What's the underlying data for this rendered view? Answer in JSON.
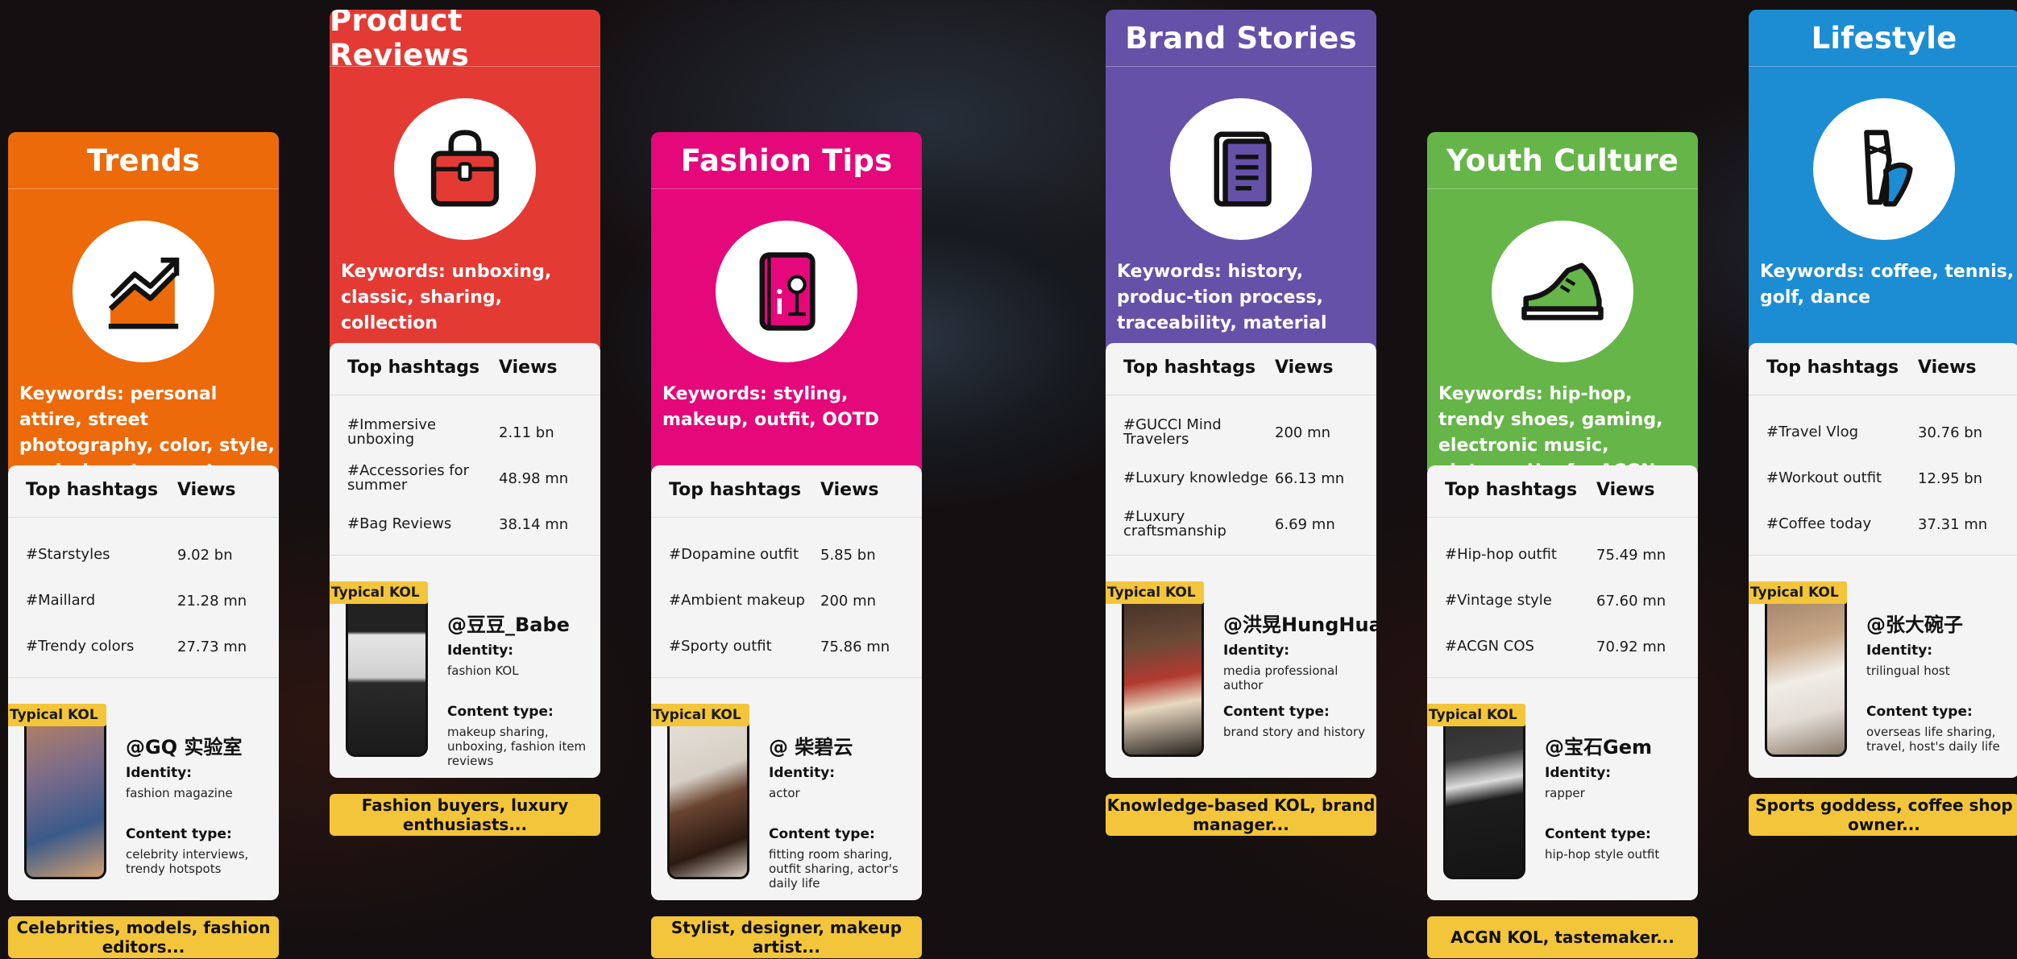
{
  "labels": {
    "top_hashtags": "Top hashtags",
    "views": "Views",
    "typical_kol": "Typical KOL",
    "identity": "Identity:",
    "content_type": "Content type:"
  },
  "columns": [
    {
      "title": "Trends",
      "color": "#ec6a0a",
      "icon": "trend-chart-icon",
      "keywords": "Keywords: personal attire, street photography, color, style, exploring stores, star styles",
      "hashtags": [
        {
          "tag": "#Starstyles",
          "views": "9.02 bn"
        },
        {
          "tag": "#Maillard",
          "views": "21.28 mn"
        },
        {
          "tag": "#Trendy colors",
          "views": "27.73 mn"
        }
      ],
      "kol": {
        "name": "@GQ 实验室",
        "identity": "fashion magazine",
        "content": "celebrity interviews, trendy hotspots"
      },
      "footer": "Celebrities, models, fashion editors..."
    },
    {
      "title": "Product Reviews",
      "color": "#e43a34",
      "icon": "handbag-icon",
      "keywords": "Keywords: unboxing, classic, sharing, collection",
      "hashtags": [
        {
          "tag": "#Immersive unboxing",
          "views": "2.11 bn"
        },
        {
          "tag": "#Accessories for summer",
          "views": "48.98 mn"
        },
        {
          "tag": "#Bag Reviews",
          "views": "38.14 mn"
        }
      ],
      "kol": {
        "name": "@豆豆_Babe",
        "identity": "fashion KOL",
        "content": "makeup sharing, unboxing, fashion item reviews"
      },
      "footer": "Fashion buyers, luxury enthusiasts..."
    },
    {
      "title": "Fashion Tips",
      "color": "#e4087a",
      "icon": "tips-book-icon",
      "keywords": "Keywords: styling, makeup, outfit, OOTD",
      "hashtags": [
        {
          "tag": "#Dopamine outfit",
          "views": "5.85 bn"
        },
        {
          "tag": "#Ambient makeup",
          "views": "200 mn"
        },
        {
          "tag": "#Sporty outfit",
          "views": "75.86 mn"
        }
      ],
      "kol": {
        "name": "@ 柴碧云",
        "identity": "actor",
        "content": "fitting room sharing, outfit sharing, actor's daily life"
      },
      "footer": "Stylist, designer, makeup artist..."
    },
    {
      "title": "Brand Stories",
      "color": "#6551a8",
      "icon": "book-icon",
      "keywords": "Keywords: history, produc-tion process, traceability, material",
      "hashtags": [
        {
          "tag": "#GUCCI Mind Travelers",
          "views": "200 mn"
        },
        {
          "tag": "#Luxury knowledge",
          "views": "66.13 mn"
        },
        {
          "tag": "#Luxury craftsmanship",
          "views": "6.69 mn"
        }
      ],
      "kol": {
        "name": "@洪晃HungHuang",
        "identity": "media professional author",
        "content": "brand story and history"
      },
      "footer": "Knowledge-based KOL, brand manager..."
    },
    {
      "title": "Youth Culture",
      "color": "#66b548",
      "icon": "sneaker-icon",
      "keywords": "Keywords: hip-hop, trendy shoes, gaming, electronic music, vintage, Hanfu, ACGN",
      "hashtags": [
        {
          "tag": "#Hip-hop outfit",
          "views": "75.49 mn"
        },
        {
          "tag": "#Vintage style",
          "views": "67.60 mn"
        },
        {
          "tag": "#ACGN COS",
          "views": "70.92 mn"
        }
      ],
      "kol": {
        "name": "@宝石Gem",
        "identity": "rapper",
        "content": "hip-hop style outfit"
      },
      "footer": "ACGN KOL, tastemaker..."
    },
    {
      "title": "Lifestyle",
      "color": "#1d8dd3",
      "icon": "ballet-shoes-icon",
      "keywords": "Keywords: coffee, tennis, golf, dance",
      "hashtags": [
        {
          "tag": "#Travel Vlog",
          "views": "30.76 bn"
        },
        {
          "tag": "#Workout outfit",
          "views": "12.95 bn"
        },
        {
          "tag": "#Coffee today",
          "views": "37.31 mn"
        }
      ],
      "kol": {
        "name": "@张大碗子",
        "identity": "trilingual host",
        "content": "overseas life sharing, travel, host's daily life"
      },
      "footer": "Sports goddess, coffee shop owner..."
    }
  ]
}
